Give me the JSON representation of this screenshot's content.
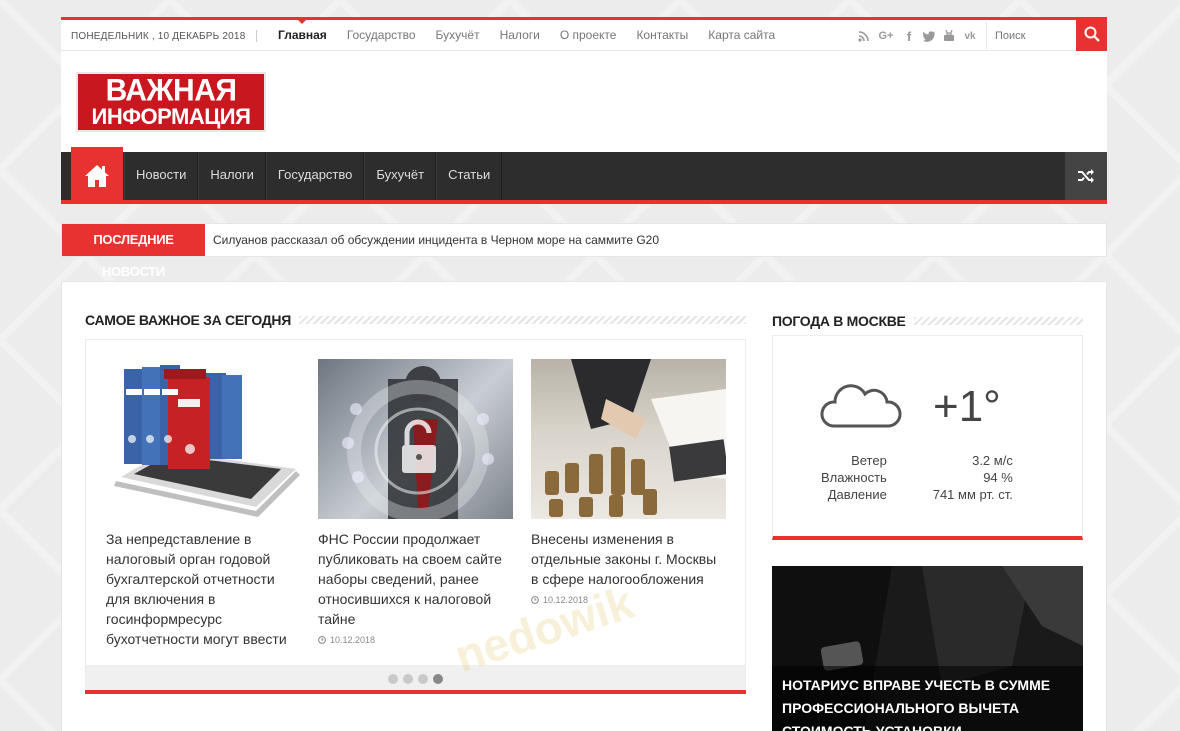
{
  "topbar": {
    "date": "ПОНЕДЕЛЬНИК , 10 ДЕКАБРЬ 2018",
    "nav": [
      "Главная",
      "Государство",
      "Бухучёт",
      "Налоги",
      "О проекте",
      "Контакты",
      "Карта сайта"
    ],
    "active": "Главная",
    "social_icons": [
      "rss-icon",
      "google-plus-icon",
      "facebook-icon",
      "twitter-icon",
      "youtube-icon",
      "vk-icon"
    ],
    "search_placeholder": "Поиск"
  },
  "logo": {
    "line1": "ВАЖНАЯ",
    "line2": "ИНФОРМАЦИЯ"
  },
  "mainnav": {
    "items": [
      "Новости",
      "Налоги",
      "Государство",
      "Бухучёт",
      "Статьи"
    ]
  },
  "breaking": {
    "label": "ПОСЛЕДНИЕ НОВОСТИ",
    "text": "Силуанов рассказал об обсуждении инцидента в Черном море на саммите G20"
  },
  "featured": {
    "title": "САМОЕ ВАЖНОЕ ЗА СЕГОДНЯ",
    "slides": [
      {
        "caption": "За непредставление в налоговый орган годовой бухгалтерской отчетности для включения в госинформресурс бухотчетности могут ввести",
        "date": ""
      },
      {
        "caption": "ФНС России продолжает публиковать на своем сайте наборы сведений, ранее относившихся к налоговой тайне",
        "date": "10.12.2018"
      },
      {
        "caption": "Внесены изменения в отдельные законы г. Москвы в сфере налогообложения",
        "date": "10.12.2018"
      }
    ],
    "dots_count": 4,
    "active_dot": 4
  },
  "weather": {
    "title": "ПОГОДА В МОСКВЕ",
    "temp": "+1°",
    "rows": [
      {
        "k": "Ветер",
        "v": "3.2 м/с"
      },
      {
        "k": "Влажность",
        "v": "94 %"
      },
      {
        "k": "Давление",
        "v": "741 мм рт. ст."
      }
    ]
  },
  "promo": {
    "caption": "НОТАРИУС ВПРАВЕ УЧЕСТЬ В СУММЕ ПРОФЕССИОНАЛЬНОГО ВЫЧЕТА СТОИМОСТЬ УСТАНОВКИ СИГНАЛИЗАЦИИ И УСЛУГ ОХРАНЫ"
  },
  "watermark": "nedowik"
}
